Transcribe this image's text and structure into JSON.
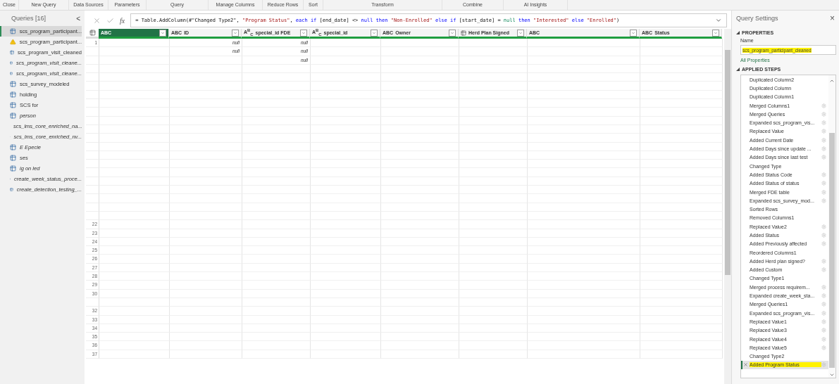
{
  "ribbon": {
    "groups": [
      "Close",
      "New Query",
      "Data Sources",
      "Parameters",
      "Query",
      "Manage Columns",
      "Reduce Rows",
      "Sort",
      "Transform",
      "Combine",
      "AI Insights"
    ]
  },
  "queries": {
    "title": "Queries [16]",
    "collapse": "<",
    "items": [
      {
        "label": "scs_program_participant...",
        "italic": false,
        "selected": true,
        "warning": false
      },
      {
        "label": "scs_program_participant...",
        "italic": false,
        "selected": false,
        "warning": true
      },
      {
        "label": "scs_program_visit_cleaned",
        "italic": false,
        "selected": false,
        "warning": false
      },
      {
        "label": "scs_program_visit_cleane...",
        "italic": true,
        "selected": false,
        "warning": false
      },
      {
        "label": "scs_program_visit_cleane...",
        "italic": true,
        "selected": false,
        "warning": false
      },
      {
        "label": "scs_survey_modeled",
        "italic": false,
        "selected": false,
        "warning": false
      },
      {
        "label": "holding",
        "italic": false,
        "selected": false,
        "warning": false
      },
      {
        "label": "SCS for",
        "italic": false,
        "selected": false,
        "warning": false
      },
      {
        "label": "person",
        "italic": true,
        "selected": false,
        "warning": false
      },
      {
        "label": "scs_lms_core_enriched_na...",
        "italic": true,
        "selected": false,
        "warning": false
      },
      {
        "label": "scs_lms_core_enriched_nv...",
        "italic": true,
        "selected": false,
        "warning": false
      },
      {
        "label": "E Epecie",
        "italic": true,
        "selected": false,
        "warning": false
      },
      {
        "label": "ses",
        "italic": true,
        "selected": false,
        "warning": false
      },
      {
        "label": "ig on led",
        "italic": true,
        "selected": false,
        "warning": false
      },
      {
        "label": "create_week_status_proce...",
        "italic": true,
        "selected": false,
        "warning": false
      },
      {
        "label": "create_detection_testing_...",
        "italic": true,
        "selected": false,
        "warning": false
      }
    ]
  },
  "formula_bar": {
    "fx_label": "fx",
    "segments": [
      {
        "text": "= Table.AddColumn(#\"Changed Type2\", ",
        "kind": "plain"
      },
      {
        "text": "\"Program Status\"",
        "kind": "string"
      },
      {
        "text": ", ",
        "kind": "plain"
      },
      {
        "text": "each if",
        "kind": "keyword"
      },
      {
        "text": " [end_date] <> ",
        "kind": "plain"
      },
      {
        "text": "null then",
        "kind": "keyword"
      },
      {
        "text": " \"Non-Enrolled\"",
        "kind": "string"
      },
      {
        "text": " else if",
        "kind": "keyword"
      },
      {
        "text": " [start_date] = ",
        "kind": "plain"
      },
      {
        "text": "null",
        "kind": "literal"
      },
      {
        "text": " then",
        "kind": "keyword"
      },
      {
        "text": " \"Interested\"",
        "kind": "string"
      },
      {
        "text": " else",
        "kind": "keyword"
      },
      {
        "text": " \"Enrolled\"",
        "kind": "string"
      },
      {
        "text": ")",
        "kind": "plain"
      }
    ]
  },
  "table": {
    "columns": [
      {
        "kind": "any",
        "type_icon": "ABC",
        "selected": true
      },
      {
        "label": "ID",
        "kind": "any",
        "type_icon": "ABC",
        "selected": false
      },
      {
        "label": "special_id FDE",
        "kind": "text",
        "type_icon": "A$^{B}$$_{C}$",
        "selected": false
      },
      {
        "label": "special_id",
        "kind": "text",
        "type_icon": "A$^{B}$$_{C}$",
        "selected": false
      },
      {
        "label": "Owner",
        "kind": "any",
        "type_icon": "ABC",
        "selected": false
      },
      {
        "label": "Herd Plan Signed",
        "kind": "table",
        "selected": false
      },
      {
        "kind": "any",
        "type_icon": "ABC",
        "selected": false
      },
      {
        "label": "Status",
        "kind": "any",
        "type_icon": "ABC",
        "selected": false
      }
    ],
    "rows": [
      {
        "number": "1",
        "cells": [
          null,
          "null",
          "null",
          null,
          null,
          null,
          null,
          null
        ]
      },
      {
        "number": null,
        "cells": [
          null,
          "null",
          "null",
          null,
          null,
          null,
          null,
          null
        ]
      },
      {
        "number": null,
        "cells": [
          null,
          null,
          "null",
          null,
          null,
          null,
          null,
          null
        ]
      },
      {
        "number": null,
        "cells": []
      },
      {
        "number": null,
        "cells": []
      },
      {
        "number": null,
        "cells": []
      },
      {
        "number": null,
        "cells": []
      },
      {
        "number": null,
        "cells": []
      },
      {
        "number": null,
        "cells": []
      },
      {
        "number": null,
        "cells": []
      },
      {
        "number": null,
        "cells": []
      },
      {
        "number": null,
        "cells": []
      },
      {
        "number": null,
        "cells": []
      },
      {
        "number": null,
        "cells": []
      },
      {
        "number": null,
        "cells": []
      },
      {
        "number": null,
        "cells": []
      },
      {
        "number": null,
        "cells": []
      },
      {
        "number": null,
        "cells": []
      },
      {
        "number": null,
        "cells": []
      },
      {
        "number": null,
        "cells": []
      },
      {
        "number": null,
        "cells": []
      },
      {
        "number": "22",
        "cells": []
      },
      {
        "number": "23",
        "cells": []
      },
      {
        "number": "24",
        "cells": []
      },
      {
        "number": "25",
        "cells": []
      },
      {
        "number": "26",
        "cells": []
      },
      {
        "number": "27",
        "cells": []
      },
      {
        "number": "28",
        "cells": []
      },
      {
        "number": "29",
        "cells": []
      },
      {
        "number": "30",
        "cells": []
      },
      {
        "number": null,
        "cells": []
      },
      {
        "number": "32",
        "cells": []
      },
      {
        "number": "33",
        "cells": []
      },
      {
        "number": "34",
        "cells": []
      },
      {
        "number": "35",
        "cells": []
      },
      {
        "number": "36",
        "cells": []
      },
      {
        "number": "37",
        "cells": []
      }
    ]
  },
  "query_settings": {
    "title": "Query Settings",
    "close": "×",
    "properties_heading": "PROPERTIES",
    "name_label": "Name",
    "name_value": "scs_program_participant_cleaned",
    "all_properties": "All Properties",
    "steps_heading": "APPLIED STEPS",
    "steps": [
      {
        "label": "Duplicated Column2",
        "settings": false,
        "selected": false
      },
      {
        "label": "Duplicated Column",
        "settings": false,
        "selected": false
      },
      {
        "label": "Duplicated Column1",
        "settings": false,
        "selected": false
      },
      {
        "label": "Merged Columns1",
        "settings": true,
        "selected": false
      },
      {
        "label": "Merged Queries",
        "settings": true,
        "selected": false
      },
      {
        "label": "Expanded scs_program_vis...",
        "settings": true,
        "selected": false
      },
      {
        "label": "Replaced Value",
        "settings": true,
        "selected": false
      },
      {
        "label": "Added Current Date",
        "settings": true,
        "selected": false
      },
      {
        "label": "Added Days since update ...",
        "settings": true,
        "selected": false
      },
      {
        "label": "Added Days since last test",
        "settings": true,
        "selected": false
      },
      {
        "label": "Changed Type",
        "settings": false,
        "selected": false
      },
      {
        "label": "Added Status Code",
        "settings": true,
        "selected": false
      },
      {
        "label": "Added Status of status",
        "settings": true,
        "selected": false
      },
      {
        "label": "Merged FDE table",
        "settings": true,
        "selected": false
      },
      {
        "label": "Expanded scs_survey_mod...",
        "settings": true,
        "selected": false
      },
      {
        "label": "Sorted Rows",
        "settings": false,
        "selected": false
      },
      {
        "label": "Removed Columns1",
        "settings": false,
        "selected": false
      },
      {
        "label": "Replaced Value2",
        "settings": true,
        "selected": false
      },
      {
        "label": "Added Status",
        "settings": true,
        "selected": false
      },
      {
        "label": "Added Previously affected",
        "settings": true,
        "selected": false
      },
      {
        "label": "Reordered Columns1",
        "settings": false,
        "selected": false
      },
      {
        "label": "Added Herd plan signed?",
        "settings": true,
        "selected": false
      },
      {
        "label": "Added Custom",
        "settings": true,
        "selected": false
      },
      {
        "label": "Changed Type1",
        "settings": false,
        "selected": false
      },
      {
        "label": "Merged process requirem...",
        "settings": true,
        "selected": false
      },
      {
        "label": "Expanded create_week_sta...",
        "settings": true,
        "selected": false
      },
      {
        "label": "Merged Queries1",
        "settings": true,
        "selected": false
      },
      {
        "label": "Expanded scs_program_vis...",
        "settings": true,
        "selected": false
      },
      {
        "label": "Replaced Value1",
        "settings": true,
        "selected": false
      },
      {
        "label": "Replaced Value3",
        "settings": true,
        "selected": false
      },
      {
        "label": "Replaced Value4",
        "settings": true,
        "selected": false
      },
      {
        "label": "Replaced Value5",
        "settings": true,
        "selected": false
      },
      {
        "label": "Changed Type2",
        "settings": false,
        "selected": false
      },
      {
        "label": "Added Program Status",
        "settings": true,
        "selected": true
      }
    ]
  }
}
